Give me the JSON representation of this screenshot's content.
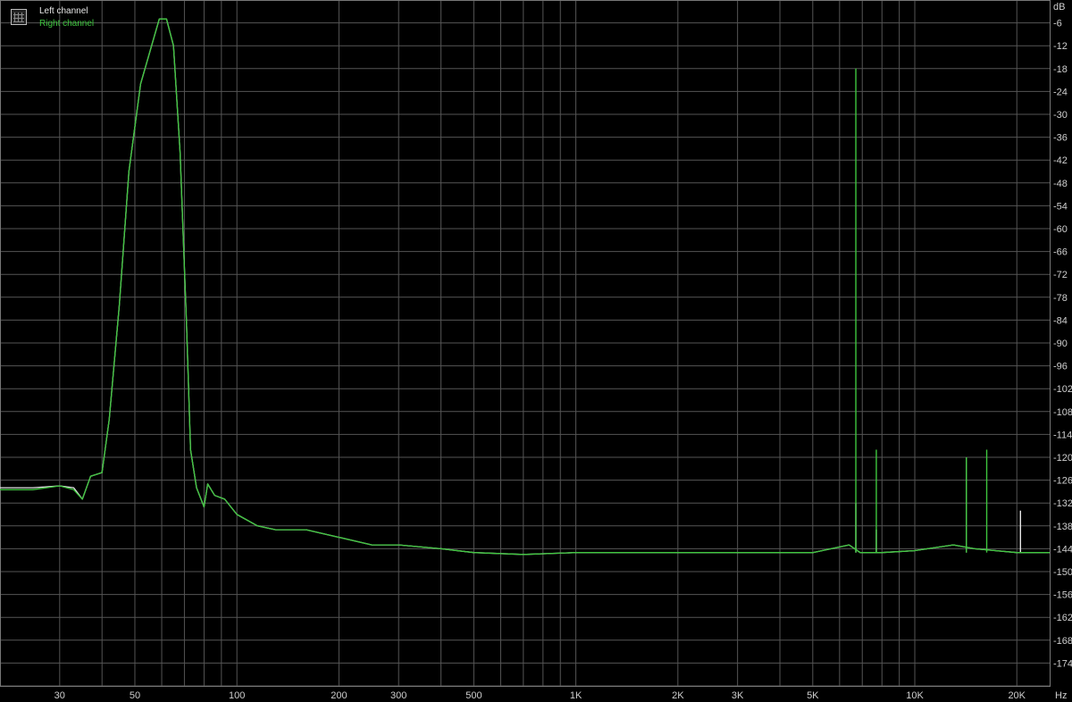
{
  "chart_data": {
    "type": "line",
    "title": "",
    "xlabel": "",
    "ylabel": "",
    "x_scale": "log",
    "xlim": [
      20,
      25000
    ],
    "ylim": [
      -180,
      0
    ],
    "grid": true,
    "legend_position": "top-left",
    "x_unit": "Hz",
    "y_unit": "dB",
    "x_ticks": [
      {
        "value": 30,
        "label": "30"
      },
      {
        "value": 50,
        "label": "50"
      },
      {
        "value": 100,
        "label": "100"
      },
      {
        "value": 200,
        "label": "200"
      },
      {
        "value": 300,
        "label": "300"
      },
      {
        "value": 500,
        "label": "500"
      },
      {
        "value": 1000,
        "label": "1K"
      },
      {
        "value": 2000,
        "label": "2K"
      },
      {
        "value": 3000,
        "label": "3K"
      },
      {
        "value": 5000,
        "label": "5K"
      },
      {
        "value": 10000,
        "label": "10K"
      },
      {
        "value": 20000,
        "label": "20K"
      }
    ],
    "y_ticks": [
      "-6",
      "-12",
      "-18",
      "-24",
      "-30",
      "-36",
      "-42",
      "-48",
      "-54",
      "-60",
      "-66",
      "-72",
      "-78",
      "-84",
      "-90",
      "-96",
      "-102",
      "-108",
      "-114",
      "-120",
      "-126",
      "-132",
      "-138",
      "-144",
      "-150",
      "-156",
      "-162",
      "-168",
      "-174"
    ],
    "series": [
      {
        "name": "Left channel",
        "color": "#e6e6e6",
        "points": [
          [
            20,
            -128
          ],
          [
            25,
            -128
          ],
          [
            30,
            -127.5
          ],
          [
            33,
            -128
          ],
          [
            35,
            -131
          ],
          [
            37,
            -125
          ],
          [
            40,
            -124
          ],
          [
            42,
            -110
          ],
          [
            45,
            -80
          ],
          [
            48,
            -45
          ],
          [
            52,
            -22
          ],
          [
            56,
            -12
          ],
          [
            59,
            -5
          ],
          [
            62,
            -5
          ],
          [
            65,
            -12
          ],
          [
            68,
            -40
          ],
          [
            71,
            -85
          ],
          [
            73,
            -118
          ],
          [
            76,
            -128
          ],
          [
            80,
            -133
          ],
          [
            82,
            -127
          ],
          [
            86,
            -130
          ],
          [
            92,
            -131
          ],
          [
            100,
            -135
          ],
          [
            115,
            -138
          ],
          [
            130,
            -139
          ],
          [
            160,
            -139
          ],
          [
            200,
            -141
          ],
          [
            250,
            -143
          ],
          [
            300,
            -143
          ],
          [
            400,
            -144
          ],
          [
            500,
            -145
          ],
          [
            700,
            -145.5
          ],
          [
            1000,
            -145
          ],
          [
            2000,
            -145
          ],
          [
            3000,
            -145
          ],
          [
            5000,
            -145
          ],
          [
            6400,
            -143
          ],
          [
            6900,
            -145
          ],
          [
            8000,
            -145
          ],
          [
            10000,
            -144.5
          ],
          [
            13000,
            -143
          ],
          [
            15000,
            -144
          ],
          [
            20000,
            -145
          ],
          [
            25000,
            -145
          ]
        ],
        "spikes": [
          [
            6700,
            -132
          ],
          [
            7700,
            -139
          ],
          [
            14200,
            -120
          ],
          [
            20500,
            -134
          ]
        ]
      },
      {
        "name": "Right channel",
        "color": "#3ec63e",
        "points": [
          [
            20,
            -128.5
          ],
          [
            25,
            -128.5
          ],
          [
            30,
            -127.5
          ],
          [
            33,
            -128.5
          ],
          [
            35,
            -131
          ],
          [
            37,
            -125
          ],
          [
            40,
            -124
          ],
          [
            42,
            -110
          ],
          [
            45,
            -80
          ],
          [
            48,
            -45
          ],
          [
            52,
            -22
          ],
          [
            56,
            -12
          ],
          [
            59,
            -5
          ],
          [
            62,
            -5
          ],
          [
            65,
            -12
          ],
          [
            68,
            -40
          ],
          [
            71,
            -85
          ],
          [
            73,
            -118
          ],
          [
            76,
            -128
          ],
          [
            80,
            -133
          ],
          [
            82,
            -127
          ],
          [
            86,
            -130
          ],
          [
            92,
            -131
          ],
          [
            100,
            -135
          ],
          [
            115,
            -138
          ],
          [
            130,
            -139
          ],
          [
            160,
            -139
          ],
          [
            200,
            -141
          ],
          [
            250,
            -143
          ],
          [
            300,
            -143
          ],
          [
            400,
            -144
          ],
          [
            500,
            -145
          ],
          [
            700,
            -145.5
          ],
          [
            1000,
            -145
          ],
          [
            2000,
            -145
          ],
          [
            3000,
            -145
          ],
          [
            5000,
            -145
          ],
          [
            6400,
            -143
          ],
          [
            6900,
            -145
          ],
          [
            8000,
            -145
          ],
          [
            10000,
            -144.5
          ],
          [
            13000,
            -143
          ],
          [
            15000,
            -144
          ],
          [
            20000,
            -145
          ],
          [
            25000,
            -145
          ]
        ],
        "spikes": [
          [
            6700,
            -18
          ],
          [
            7700,
            -118
          ],
          [
            14200,
            -120
          ],
          [
            16300,
            -118
          ]
        ]
      }
    ]
  }
}
